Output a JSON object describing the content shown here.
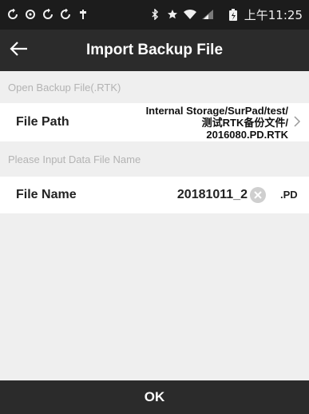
{
  "status_bar": {
    "left_icons": [
      "sync-icon",
      "refresh-icon",
      "sync-icon",
      "sync-icon",
      "usb-icon"
    ],
    "right_icons": [
      "bluetooth-icon",
      "star-icon",
      "wifi-icon",
      "signal-icon",
      "battery-icon"
    ],
    "time": "上午11:25"
  },
  "header": {
    "back_icon": "arrow-left-icon",
    "title": "Import Backup File"
  },
  "sections": {
    "open_backup": "Open Backup File(.RTK)",
    "input_name": "Please Input Data File Name"
  },
  "file_path": {
    "label": "File Path",
    "value_line1": "Internal Storage/SurPad/test/",
    "value_line2": "测试RTK备份文件/",
    "value_line3": "2016080.PD.RTK"
  },
  "file_name": {
    "label": "File Name",
    "value": "20181011_2",
    "suffix": ".PD"
  },
  "footer": {
    "ok_label": "OK"
  },
  "colors": {
    "dark_bar": "#2b2b2b",
    "status_bar": "#1c1c1c",
    "background": "#efefef",
    "section_text": "#b3b3b3"
  }
}
